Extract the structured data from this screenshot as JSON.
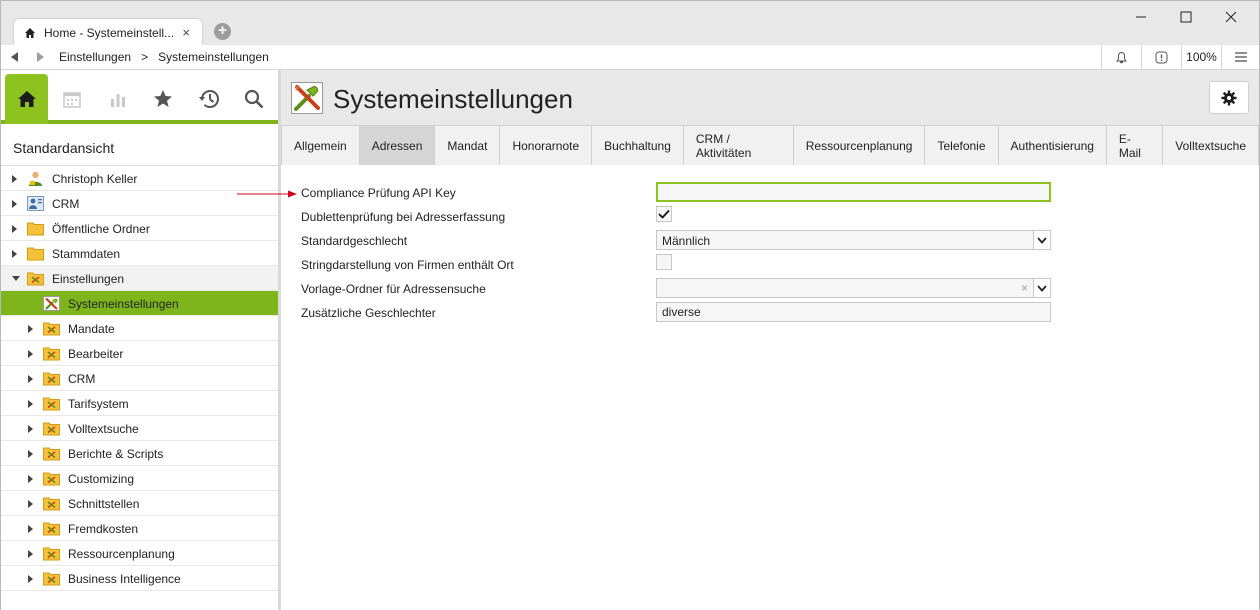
{
  "window": {
    "tab_title": "Home - Systemeinstell...",
    "tab_close": "×"
  },
  "navbar": {
    "breadcrumbs": [
      "Einstellungen",
      ">",
      "Systemeinstellungen"
    ],
    "zoom": "100%"
  },
  "sidebar": {
    "view_title": "Standardansicht",
    "icons": [
      "home-icon",
      "calendar-icon",
      "chart-icon",
      "star-icon",
      "history-icon",
      "search-icon"
    ],
    "tree": [
      {
        "label": "Christoph Keller",
        "icon": "user-icon",
        "level": 0,
        "state": "closed"
      },
      {
        "label": "CRM",
        "icon": "crm-icon",
        "level": 0,
        "state": "closed"
      },
      {
        "label": "Öffentliche Ordner",
        "icon": "folder-icon",
        "level": 0,
        "state": "closed"
      },
      {
        "label": "Stammdaten",
        "icon": "folder-icon",
        "level": 0,
        "state": "closed"
      },
      {
        "label": "Einstellungen",
        "icon": "settings-folder-icon",
        "level": 0,
        "state": "open"
      },
      {
        "label": "Systemeinstellungen",
        "icon": "tools-icon",
        "level": 1,
        "state": "none",
        "selected": true
      },
      {
        "label": "Mandate",
        "icon": "settings-folder-icon",
        "level": 1,
        "state": "closed"
      },
      {
        "label": "Bearbeiter",
        "icon": "settings-folder-icon",
        "level": 1,
        "state": "closed"
      },
      {
        "label": "CRM",
        "icon": "settings-folder-icon",
        "level": 1,
        "state": "closed"
      },
      {
        "label": "Tarifsystem",
        "icon": "settings-folder-icon",
        "level": 1,
        "state": "closed"
      },
      {
        "label": "Volltextsuche",
        "icon": "settings-folder-icon",
        "level": 1,
        "state": "closed"
      },
      {
        "label": "Berichte & Scripts",
        "icon": "settings-folder-icon",
        "level": 1,
        "state": "closed"
      },
      {
        "label": "Customizing",
        "icon": "settings-folder-icon",
        "level": 1,
        "state": "closed"
      },
      {
        "label": "Schnittstellen",
        "icon": "settings-folder-icon",
        "level": 1,
        "state": "closed"
      },
      {
        "label": "Fremdkosten",
        "icon": "settings-folder-icon",
        "level": 1,
        "state": "closed"
      },
      {
        "label": "Ressourcenplanung",
        "icon": "settings-folder-icon",
        "level": 1,
        "state": "closed"
      },
      {
        "label": "Business Intelligence",
        "icon": "settings-folder-icon",
        "level": 1,
        "state": "closed"
      }
    ]
  },
  "main": {
    "title": "Systemeinstellungen",
    "tabs": [
      {
        "label": "Allgemein",
        "active": false
      },
      {
        "label": "Adressen",
        "active": true
      },
      {
        "label": "Mandat",
        "active": false
      },
      {
        "label": "Honorarnote",
        "active": false
      },
      {
        "label": "Buchhaltung",
        "active": false
      },
      {
        "label": "CRM / Aktivitäten",
        "active": false
      },
      {
        "label": "Ressourcenplanung",
        "active": false
      },
      {
        "label": "Telefonie",
        "active": false
      },
      {
        "label": "Authentisierung",
        "active": false
      },
      {
        "label": "E-Mail",
        "active": false
      },
      {
        "label": "Volltextsuche",
        "active": false
      }
    ],
    "fields": [
      {
        "label": "Compliance Prüfung API Key",
        "type": "text",
        "value": "",
        "focused": true
      },
      {
        "label": "Dublettenprüfung bei Adresserfassung",
        "type": "checkbox",
        "checked": true
      },
      {
        "label": "Standardgeschlecht",
        "type": "select",
        "value": "Männlich"
      },
      {
        "label": "Stringdarstellung von Firmen enthält Ort",
        "type": "checkbox",
        "checked": false
      },
      {
        "label": "Vorlage-Ordner für Adressensuche",
        "type": "select-clear",
        "value": ""
      },
      {
        "label": "Zusätzliche Geschlechter",
        "type": "text",
        "value": "diverse",
        "focused": false
      }
    ]
  },
  "colors": {
    "accent": "#8dc21f",
    "arrow": "#d0021b"
  }
}
